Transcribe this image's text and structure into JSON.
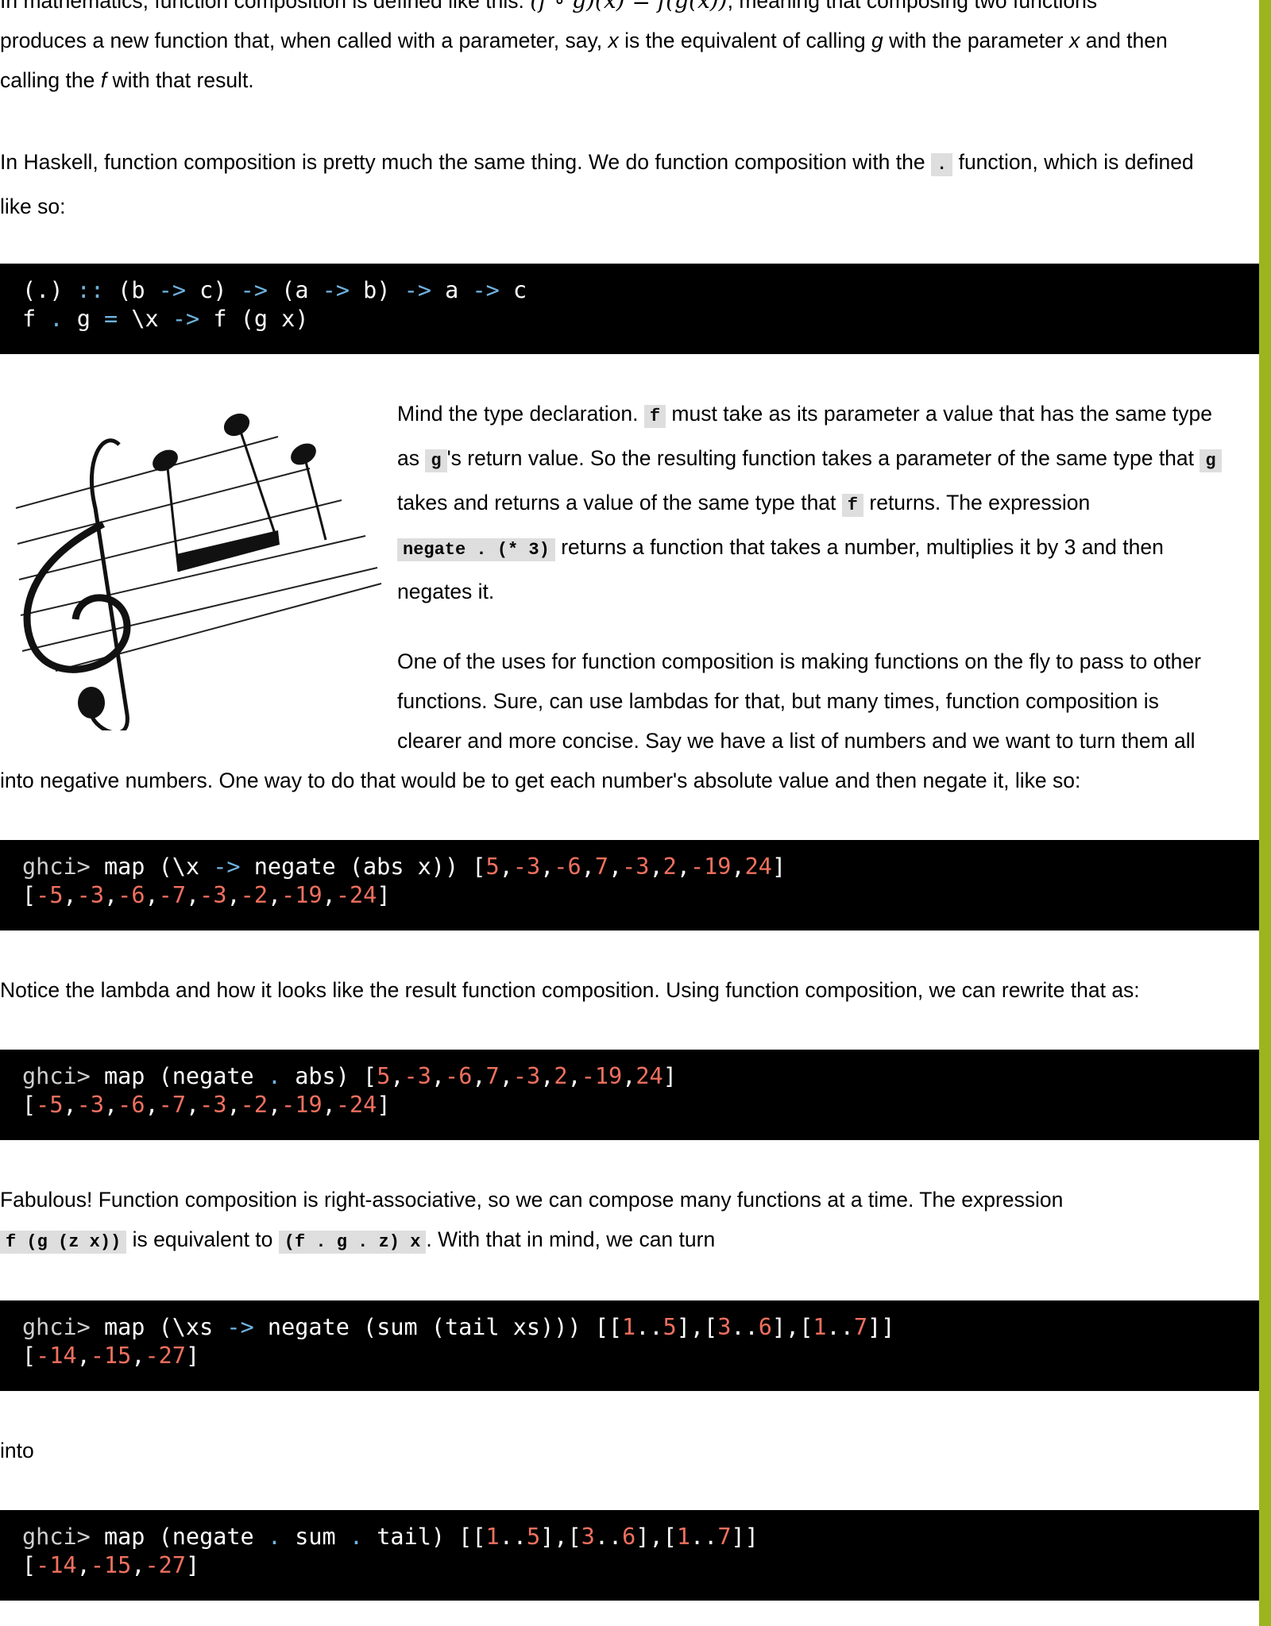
{
  "p1": {
    "a": "In mathematics, function composition is defined like this:",
    "formula": "(f ∘ g)(x) = f(g(x))",
    "b": ", meaning that composing two functions",
    "c": "produces a new function that, when called with a parameter, say,",
    "x1": "x",
    "d": "is the equivalent of calling",
    "g1": "g",
    "e": "with the parameter",
    "x2": "x",
    "f": "and then",
    "g": "calling the",
    "f1": "f",
    "h": "with that result."
  },
  "p2": {
    "a": "In Haskell, function composition is pretty much the same thing. We do function composition with the",
    "code": ".",
    "b": "function, which is defined",
    "c": "like so:"
  },
  "code1": {
    "l1_a": "(.)",
    "l1_b": "::",
    "l1_c": "(b",
    "l1_d": "->",
    "l1_e": "c)",
    "l1_f": "->",
    "l1_g": "(a",
    "l1_h": "->",
    "l1_i": "b)",
    "l1_j": "->",
    "l1_k": "a",
    "l1_l": "->",
    "l1_m": "c",
    "l2_a": "f",
    "l2_b": ".",
    "l2_c": "g",
    "l2_d": "=",
    "l2_e": "\\x",
    "l2_f": "->",
    "l2_g": "f (g x)"
  },
  "p3": {
    "a": "Mind the type declaration.",
    "c1": "f",
    "b": "must take as its parameter a value that has the same type",
    "c": "as",
    "c2": "g",
    "d": "'s return value. So the resulting function takes a parameter of the same type that",
    "c3": "g",
    "e": "takes and returns a value of the same type that",
    "c4": "f",
    "f": "returns. The expression",
    "c5": "negate . (* 3)",
    "g": "returns a function that takes a number, multiplies it by 3 and then",
    "h": "negates it."
  },
  "p4": {
    "l1": "One of the uses for function composition is making functions on the fly to pass to other",
    "l2": "functions. Sure, can use lambdas for that, but many times, function composition is",
    "l3": "clearer and more concise. Say we have a list of numbers and we want to turn them all",
    "l4": "into negative numbers. One way to do that would be to get each number's absolute value and then negate it, like so:"
  },
  "code2": {
    "prompt": "ghci>",
    "cmd_a": "map (\\x",
    "arrow": "->",
    "cmd_b": "negate (abs x)) [",
    "list": [
      "5",
      "-3",
      "-6",
      "7",
      "-3",
      "2",
      "-19",
      "24"
    ],
    "result": [
      "-5",
      "-3",
      "-6",
      "-7",
      "-3",
      "-2",
      "-19",
      "-24"
    ]
  },
  "p5": "Notice the lambda and how it looks like the result function composition. Using function composition, we can rewrite that as:",
  "code3": {
    "prompt": "ghci>",
    "cmd_a": "map (negate",
    "dot": ".",
    "cmd_b": "abs) [",
    "list": [
      "5",
      "-3",
      "-6",
      "7",
      "-3",
      "2",
      "-19",
      "24"
    ],
    "result": [
      "-5",
      "-3",
      "-6",
      "-7",
      "-3",
      "-2",
      "-19",
      "-24"
    ]
  },
  "p6": {
    "a": "Fabulous! Function composition is right-associative, so we can compose many functions at a time. The expression",
    "c1": "f (g (z x))",
    "b": "is equivalent to",
    "c2": "(f . g . z) x",
    "c": ". With that in mind, we can turn"
  },
  "code4": {
    "prompt": "ghci>",
    "cmd_a": "map (\\xs",
    "arrow": "->",
    "cmd_b": "negate (sum (tail xs))) [[",
    "r1a": "1",
    "r1b": "5",
    "r2a": "3",
    "r2b": "6",
    "r3a": "1",
    "r3b": "7",
    "result": [
      "-14",
      "-15",
      "-27"
    ]
  },
  "p7": "into",
  "code5": {
    "prompt": "ghci>",
    "cmd_a": "map (negate",
    "dot1": ".",
    "cmd_b": "sum",
    "dot2": ".",
    "cmd_c": "tail) [[",
    "r1a": "1",
    "r1b": "5",
    "r2a": "3",
    "r2b": "6",
    "r3a": "1",
    "r3b": "7",
    "result": [
      "-14",
      "-15",
      "-27"
    ]
  },
  "colors": {
    "rail": "#9cb51e",
    "code_bg": "#000000",
    "operator": "#6fb3e0",
    "number": "#f0705f"
  },
  "image": {
    "name": "music-staff-illustration"
  }
}
